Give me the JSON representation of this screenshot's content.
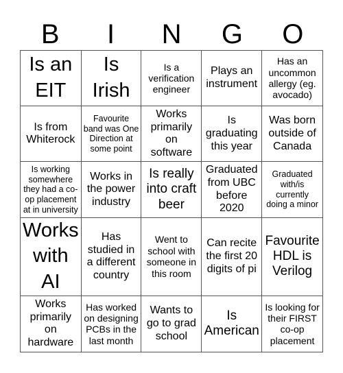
{
  "header": [
    "B",
    "I",
    "N",
    "G",
    "O"
  ],
  "cells": [
    {
      "text": "Is an EIT",
      "size": "xl"
    },
    {
      "text": "Is Irish",
      "size": "xl"
    },
    {
      "text": "Is a verification engineer",
      "size": "sm"
    },
    {
      "text": "Plays an instrument",
      "size": "md"
    },
    {
      "text": "Has an uncommon allergy (eg. avocado)",
      "size": "sm"
    },
    {
      "text": "Is from Whiterock",
      "size": "md"
    },
    {
      "text": "Favourite band was One Direction at some point",
      "size": "xs"
    },
    {
      "text": "Works primarily on software",
      "size": "md"
    },
    {
      "text": "Is graduating this year",
      "size": "md"
    },
    {
      "text": "Was born outside of Canada",
      "size": "md"
    },
    {
      "text": "Is working somewhere they had a co-op placement at in university",
      "size": "xs"
    },
    {
      "text": "Works in the power industry",
      "size": "md"
    },
    {
      "text": "Is really into craft beer",
      "size": "lg"
    },
    {
      "text": "Graduated from UBC before 2020",
      "size": "md"
    },
    {
      "text": "Graduated with/is currently doing a minor",
      "size": "xs"
    },
    {
      "text": "Works with AI",
      "size": "xl"
    },
    {
      "text": "Has studied in a different country",
      "size": "md"
    },
    {
      "text": "Went to school with someone in this room",
      "size": "sm"
    },
    {
      "text": "Can recite the first 20 digits of pi",
      "size": "md"
    },
    {
      "text": "Favourite HDL is Verilog",
      "size": "lg"
    },
    {
      "text": "Works primarily on hardware",
      "size": "md"
    },
    {
      "text": "Has worked on designing PCBs in the last month",
      "size": "sm"
    },
    {
      "text": "Wants to go to grad school",
      "size": "md"
    },
    {
      "text": "Is American",
      "size": "lg"
    },
    {
      "text": "Is looking for their FIRST co-op placement",
      "size": "sm"
    }
  ]
}
